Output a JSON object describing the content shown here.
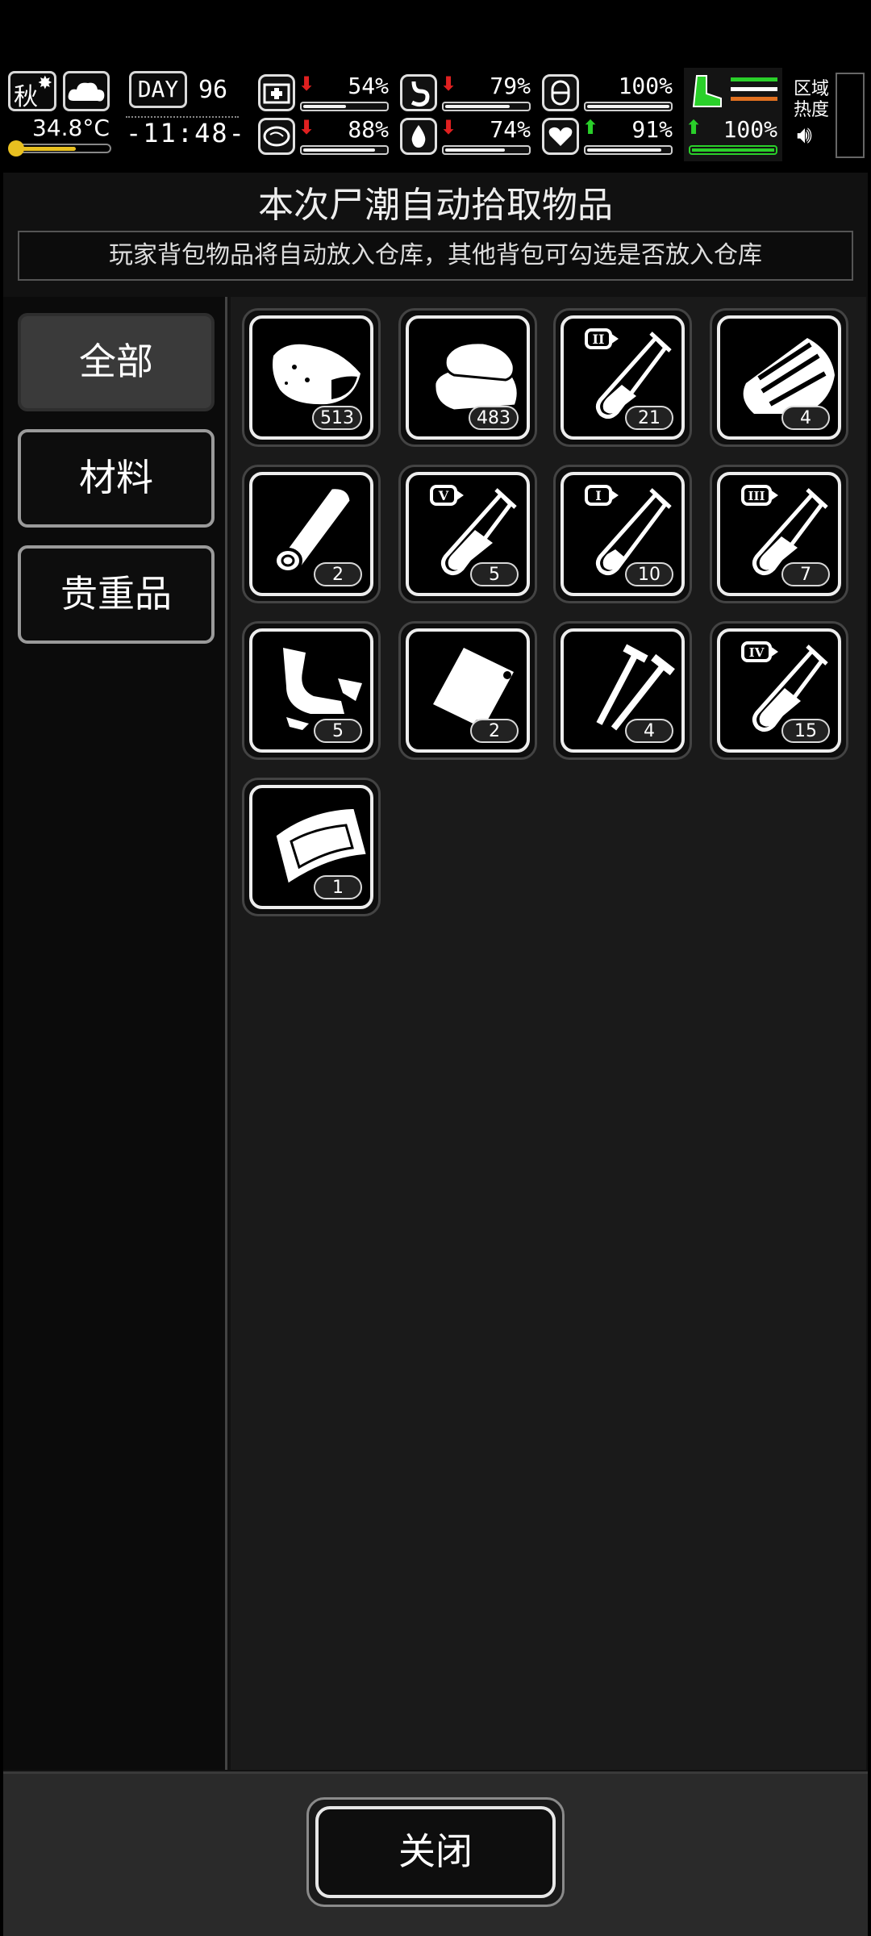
{
  "hud": {
    "season": "秋",
    "temperature": "34.8°C",
    "day_label": "DAY",
    "day_number": "96",
    "clock": "-11:48-",
    "stats": [
      {
        "name": "health",
        "value": "54%",
        "fill": 0.54,
        "trend": "down"
      },
      {
        "name": "hunger",
        "value": "79%",
        "fill": 0.79,
        "trend": "down"
      },
      {
        "name": "medicine",
        "value": "100%",
        "fill": 1.0,
        "trend": "none"
      },
      {
        "name": "mind",
        "value": "88%",
        "fill": 0.88,
        "trend": "down"
      },
      {
        "name": "thirst",
        "value": "74%",
        "fill": 0.74,
        "trend": "down"
      },
      {
        "name": "heart",
        "value": "91%",
        "fill": 0.91,
        "trend": "up"
      }
    ],
    "stamina": "100%",
    "region_label": "区域热度",
    "colors": {
      "down": "#e02020",
      "up": "#2ad02a",
      "stamina": "#2ad02a",
      "orange": "#e07020"
    }
  },
  "dialog": {
    "title": "本次尸潮自动拾取物品",
    "subtitle": "玩家背包物品将自动放入仓库，其他背包可勾选是否放入仓库"
  },
  "tabs": [
    "全部",
    "材料",
    "贵重品"
  ],
  "items": [
    {
      "icon": "meat-icon",
      "count": "513"
    },
    {
      "icon": "cloth-icon",
      "count": "483"
    },
    {
      "icon": "test-tube-ii-icon",
      "count": "21"
    },
    {
      "icon": "wood-planks-icon",
      "count": "4"
    },
    {
      "icon": "log-icon",
      "count": "2"
    },
    {
      "icon": "test-tube-v-icon",
      "count": "5"
    },
    {
      "icon": "test-tube-i-icon",
      "count": "10"
    },
    {
      "icon": "test-tube-iii-icon",
      "count": "7"
    },
    {
      "icon": "scrap-metal-icon",
      "count": "5"
    },
    {
      "icon": "plastic-bag-icon",
      "count": "2"
    },
    {
      "icon": "nails-icon",
      "count": "4"
    },
    {
      "icon": "test-tube-iv-icon",
      "count": "15"
    },
    {
      "icon": "glass-sheet-icon",
      "count": "1"
    }
  ],
  "tube_labels": {
    "ii": "II",
    "v": "V",
    "i": "I",
    "iii": "III",
    "iv": "IV"
  },
  "close_label": "关闭"
}
